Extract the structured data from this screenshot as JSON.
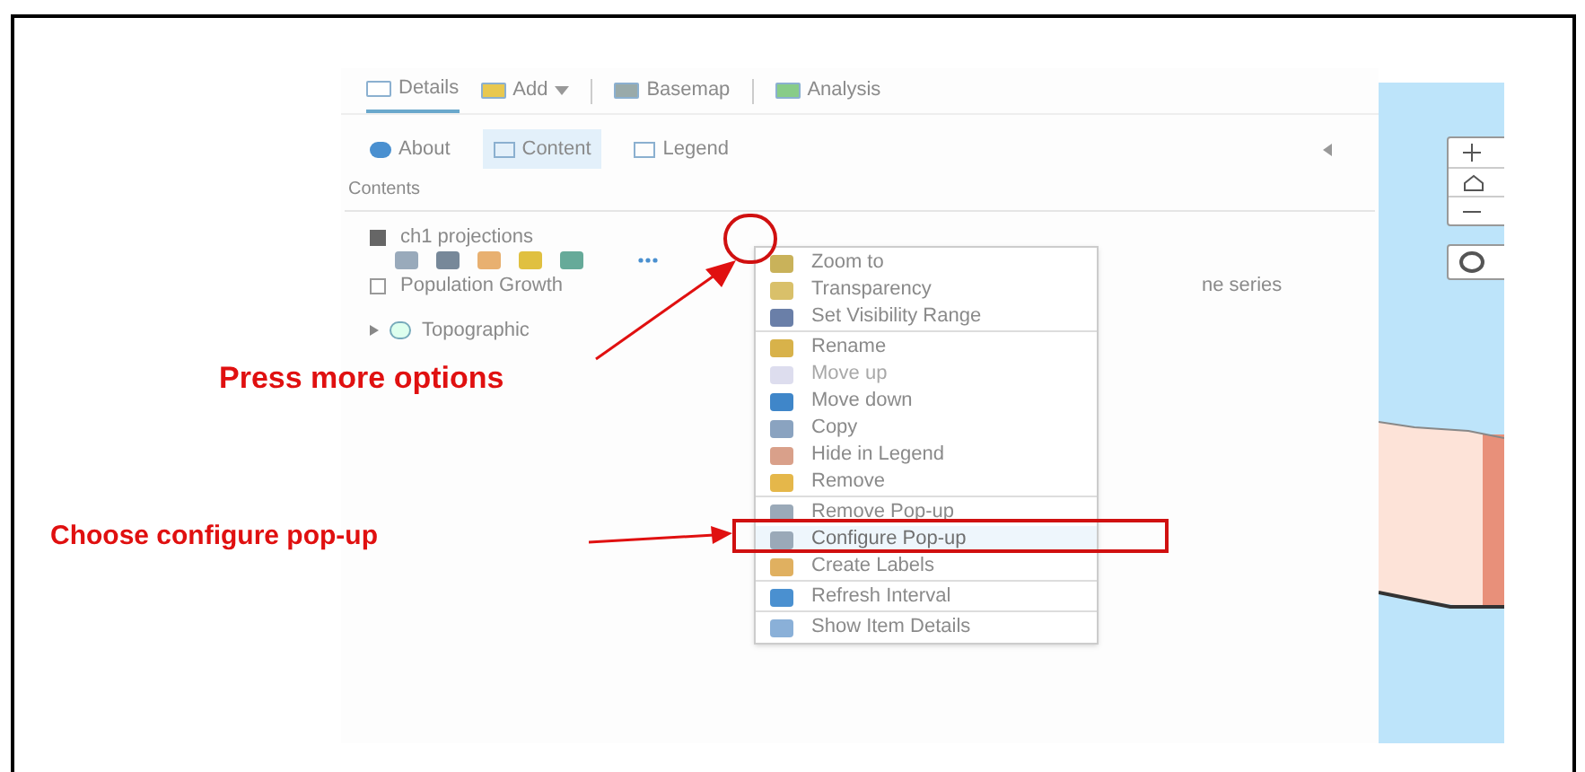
{
  "toolbar": [
    {
      "label": "Details",
      "selected": true,
      "dropdown": false
    },
    {
      "label": "Add",
      "selected": false,
      "dropdown": true
    },
    {
      "label": "Basemap",
      "selected": false,
      "dropdown": false
    },
    {
      "label": "Analysis",
      "selected": false,
      "dropdown": false
    }
  ],
  "subtabs": [
    {
      "label": "About",
      "selected": false
    },
    {
      "label": "Content",
      "selected": true
    },
    {
      "label": "Legend",
      "selected": false
    }
  ],
  "section_title": "Contents",
  "layers": [
    {
      "kind": "layer",
      "name": "ch1 projections",
      "checked": true,
      "tools": true
    },
    {
      "kind": "layer",
      "name": "Population Growth",
      "name_tail": "ne series",
      "checked": false,
      "tools": false
    },
    {
      "kind": "basemap",
      "name": "Topographic",
      "expanded": false
    }
  ],
  "menu": [
    [
      {
        "label": "Zoom to",
        "disabled": false,
        "selected": false
      },
      {
        "label": "Transparency",
        "disabled": false,
        "selected": false
      },
      {
        "label": "Set Visibility Range",
        "disabled": false,
        "selected": false
      }
    ],
    [
      {
        "label": "Rename",
        "disabled": false,
        "selected": false
      },
      {
        "label": "Move up",
        "disabled": true,
        "selected": false
      },
      {
        "label": "Move down",
        "disabled": false,
        "selected": false
      },
      {
        "label": "Copy",
        "disabled": false,
        "selected": false
      },
      {
        "label": "Hide in Legend",
        "disabled": false,
        "selected": false
      },
      {
        "label": "Remove",
        "disabled": false,
        "selected": false
      }
    ],
    [
      {
        "label": "Remove Pop-up",
        "disabled": false,
        "selected": false
      },
      {
        "label": "Configure Pop-up",
        "disabled": false,
        "selected": true
      },
      {
        "label": "Create Labels",
        "disabled": false,
        "selected": false
      }
    ],
    [
      {
        "label": "Refresh Interval",
        "disabled": false,
        "selected": false
      }
    ],
    [
      {
        "label": "Show Item Details",
        "disabled": false,
        "selected": false
      }
    ]
  ],
  "annotations": [
    {
      "text": "Press more options"
    },
    {
      "text": "Choose configure pop-up"
    }
  ]
}
